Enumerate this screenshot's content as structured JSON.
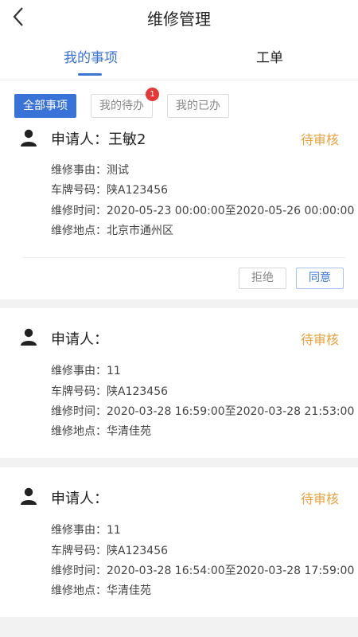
{
  "header": {
    "title": "维修管理"
  },
  "tabs": [
    {
      "label": "我的事项",
      "active": true
    },
    {
      "label": "工单",
      "active": false
    }
  ],
  "filters": {
    "all": "全部事项",
    "todo": "我的待办",
    "done": "我的已办",
    "todo_badge": "1"
  },
  "labels": {
    "reason": "维修事由：",
    "plate": "车牌号码：",
    "time": "维修时间：",
    "place": "维修地点："
  },
  "cards": [
    {
      "applicant": "申请人：王敏2",
      "status": "待审核",
      "reason": "测试",
      "plate": "陕A123456",
      "time": "2020-05-23 00:00:00至2020-05-26 00:00:00",
      "place": "北京市通州区",
      "reject_label": "拒绝",
      "agree_label": "同意"
    },
    {
      "applicant": "申请人：",
      "status": "待审核",
      "reason": "11",
      "plate": "陕A123456",
      "time": "2020-03-28 16:59:00至2020-03-28 21:53:00",
      "place": "华清佳苑"
    },
    {
      "applicant": "申请人：",
      "status": "待审核",
      "reason": "11",
      "plate": "陕A123456",
      "time": "2020-03-28 16:54:00至2020-03-28 17:59:00",
      "place": "华清佳苑"
    }
  ],
  "colors": {
    "accent": "#3a73d8",
    "status": "#e6a23c",
    "badge": "#e53935"
  }
}
